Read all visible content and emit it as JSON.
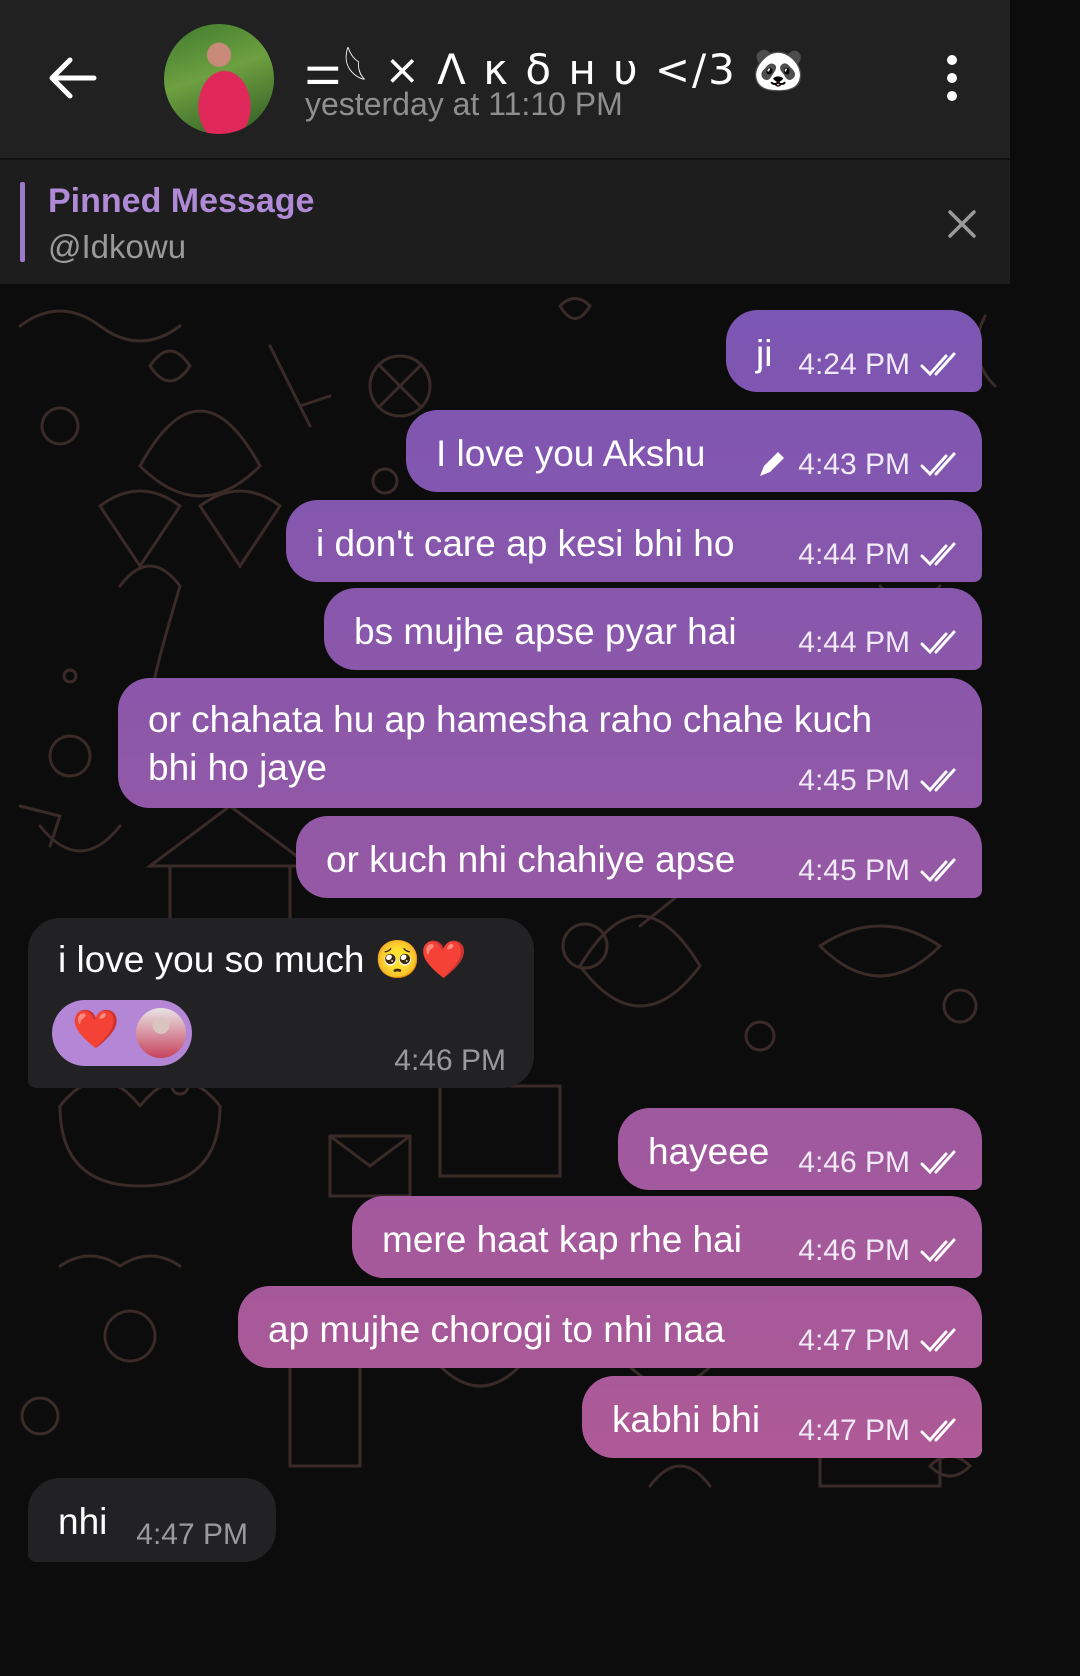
{
  "header": {
    "title": "⚌𓆩 × Λ κ δ н υ </3 🐼",
    "subtitle": "yesterday at 11:10 PM"
  },
  "pinned": {
    "title": "Pinned Message",
    "text": "@Idkowu"
  },
  "messages": [
    {
      "text": "ji",
      "time": "4:24 PM",
      "out": true
    },
    {
      "text": "I love you Akshu",
      "time": "4:43 PM",
      "out": true,
      "edited": true
    },
    {
      "text": "i don't care ap kesi bhi ho",
      "time": "4:44 PM",
      "out": true
    },
    {
      "text": "bs mujhe apse pyar hai",
      "time": "4:44 PM",
      "out": true
    },
    {
      "text_line1": "or chahata hu ap hamesha raho chahe kuch",
      "text_line2": "bhi ho jaye",
      "time": "4:45 PM",
      "out": true
    },
    {
      "text": "or kuch nhi chahiye apse",
      "time": "4:45 PM",
      "out": true
    },
    {
      "text": "i love you so much 🥺❤️",
      "time": "4:46 PM",
      "out": false,
      "reaction": "❤️"
    },
    {
      "text": "hayeee",
      "time": "4:46 PM",
      "out": true
    },
    {
      "text": "mere haat kap rhe hai",
      "time": "4:46 PM",
      "out": true
    },
    {
      "text": "ap mujhe chorogi to nhi naa",
      "time": "4:47 PM",
      "out": true
    },
    {
      "text": "kabhi bhi",
      "time": "4:47 PM",
      "out": true
    },
    {
      "text": "nhi",
      "time": "4:47 PM",
      "out": false
    }
  ],
  "colors": {
    "header_bg": "#212121",
    "pinned_accent": "#b08ad6",
    "bubble_out_top": "#7a56b4",
    "bubble_out_bottom": "#b35a93",
    "bubble_in": "#222224",
    "doodle": "#3a2a28"
  }
}
